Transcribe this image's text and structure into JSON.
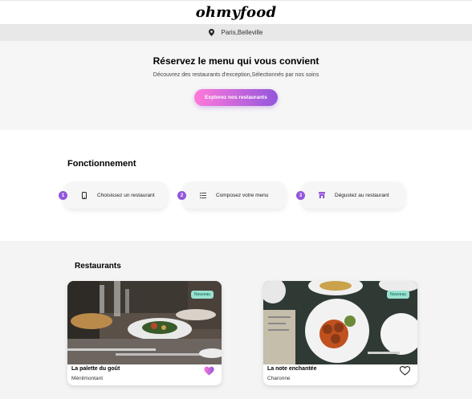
{
  "header": {
    "logo": "ohmyfood"
  },
  "location": {
    "text": "Paris,Belleville",
    "icon": "map-pin-icon"
  },
  "hero": {
    "title": "Réservez le menu qui vous convient",
    "subtitle": "Découvrez des restaurants d'exception,Sélectionnés par nos soins",
    "button_label": "Explorez nos restaurants"
  },
  "how_it_works": {
    "title": "Fonctionnement",
    "steps": [
      {
        "number": "1",
        "icon": "phone-icon",
        "label": "Choisissez un restaurant"
      },
      {
        "number": "2",
        "icon": "list-icon",
        "label": "Composez votre menu"
      },
      {
        "number": "3",
        "icon": "store-icon",
        "label": "Dégustez au restaurant"
      }
    ]
  },
  "restaurants": {
    "title": "Restaurants",
    "cards": [
      {
        "name": "La palette du goût",
        "location": "Ménilmontant",
        "badge": "Nouveau",
        "liked": true
      },
      {
        "name": "La note enchantée",
        "location": "Charonne",
        "badge": "Nouveau",
        "liked": false
      }
    ]
  },
  "colors": {
    "accent_purple": "#9356dc",
    "accent_pink": "#ff79da",
    "badge_green": "#99e2d0"
  }
}
